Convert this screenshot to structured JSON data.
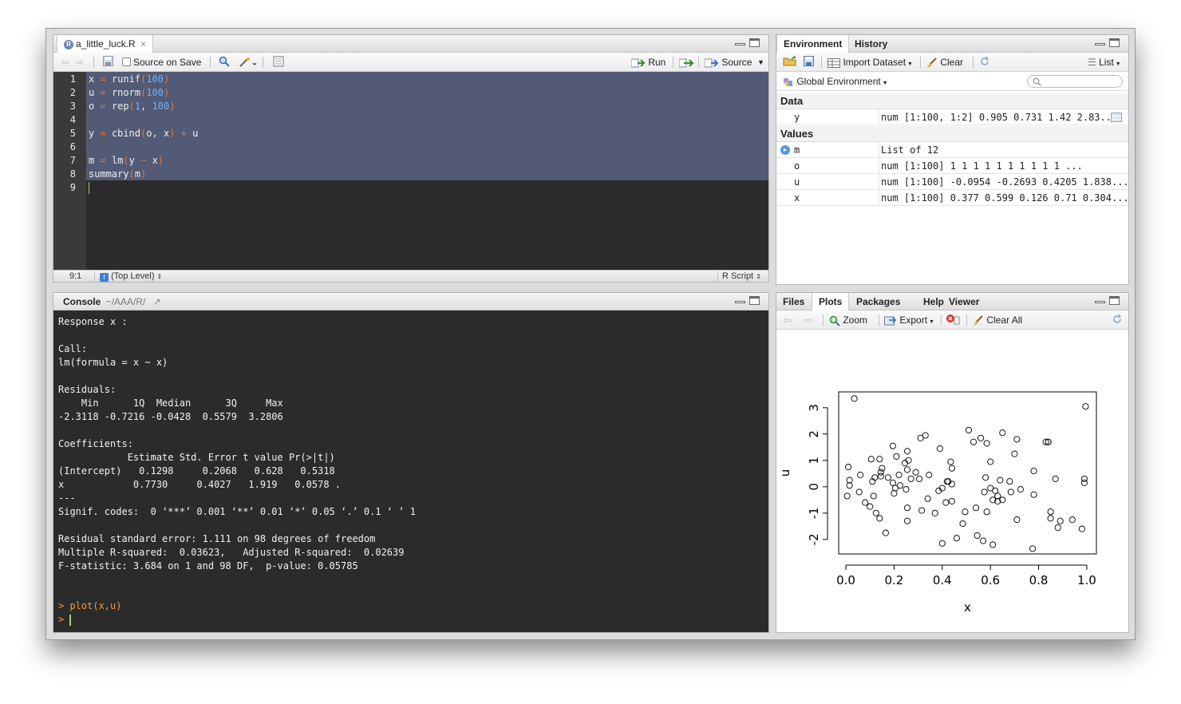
{
  "editor": {
    "tab_label": "a_little_luck.R",
    "source_on_save": "Source on Save",
    "run_label": "Run",
    "source_label": "Source",
    "lines": [
      {
        "n": "1",
        "code": "x = runif(100)"
      },
      {
        "n": "2",
        "code": "u = rnorm(100)"
      },
      {
        "n": "3",
        "code": "o = rep(1, 100)"
      },
      {
        "n": "4",
        "code": ""
      },
      {
        "n": "5",
        "code": "y = cbind(o, x) + u"
      },
      {
        "n": "6",
        "code": ""
      },
      {
        "n": "7",
        "code": "m = lm(y ~ x)"
      },
      {
        "n": "8",
        "code": "summary(m)"
      },
      {
        "n": "9",
        "code": ""
      }
    ],
    "status_position": "9:1",
    "status_scope": "(Top Level)",
    "status_filetype": "R Script"
  },
  "console": {
    "title": "Console",
    "path": "~/AAA/R/",
    "lines": [
      "Response x :",
      "",
      "Call:",
      "lm(formula = x ~ x)",
      "",
      "Residuals:",
      "    Min      1Q  Median      3Q     Max ",
      "-2.3118 -0.7216 -0.0428  0.5579  3.2806 ",
      "",
      "Coefficients:",
      "            Estimate Std. Error t value Pr(>|t|)",
      "(Intercept)   0.1298     0.2068   0.628   0.5318",
      "x            0.7730     0.4027   1.919   0.0578 .",
      "---",
      "Signif. codes:  0 ‘***’ 0.001 ‘**’ 0.01 ‘*’ 0.05 ‘.’ 0.1 ‘ ’ 1",
      "",
      "Residual standard error: 1.111 on 98 degrees of freedom",
      "Multiple R-squared:  0.03623,   Adjusted R-squared:  0.02639 ",
      "F-statistic: 3.684 on 1 and 98 DF,  p-value: 0.05785",
      "",
      ""
    ],
    "command": "> plot(x,u)",
    "prompt": ">"
  },
  "environment": {
    "tabs": [
      "Environment",
      "History"
    ],
    "import_label": "Import Dataset",
    "clear_label": "Clear",
    "list_label": "List",
    "scope_label": "Global Environment",
    "search_placeholder": "",
    "data_header": "Data",
    "values_header": "Values",
    "data_rows": [
      {
        "name": "y",
        "value": "num [1:100, 1:2] 0.905 0.731 1.42 2.83..."
      }
    ],
    "value_rows": [
      {
        "name": "m",
        "value": "List of 12"
      },
      {
        "name": "o",
        "value": "num [1:100] 1 1 1 1 1 1 1 1 1 1 ..."
      },
      {
        "name": "u",
        "value": "num [1:100] -0.0954 -0.2693 0.4205 1.838..."
      },
      {
        "name": "x",
        "value": "num [1:100] 0.377 0.599 0.126 0.71 0.304..."
      }
    ]
  },
  "plots": {
    "tabs": [
      "Files",
      "Plots",
      "Packages",
      "Help",
      "Viewer"
    ],
    "zoom_label": "Zoom",
    "export_label": "Export",
    "clear_all_label": "Clear All"
  },
  "chart_data": {
    "type": "scatter",
    "xlabel": "x",
    "ylabel": "u",
    "xlim": [
      -0.03,
      1.04
    ],
    "ylim": [
      -2.55,
      3.6
    ],
    "xticks": [
      "0.0",
      "0.2",
      "0.4",
      "0.6",
      "0.8",
      "1.0"
    ],
    "yticks": [
      "-2",
      "-1",
      "0",
      "1",
      "2",
      "3"
    ],
    "points": [
      [
        0.035,
        3.35
      ],
      [
        0.995,
        3.05
      ],
      [
        0.51,
        2.15
      ],
      [
        0.65,
        2.05
      ],
      [
        0.33,
        1.95
      ],
      [
        0.31,
        1.85
      ],
      [
        0.56,
        1.85
      ],
      [
        0.71,
        1.8
      ],
      [
        0.84,
        1.7
      ],
      [
        0.84,
        1.7
      ],
      [
        0.53,
        1.7
      ],
      [
        0.585,
        1.65
      ],
      [
        0.195,
        1.55
      ],
      [
        0.39,
        1.45
      ],
      [
        0.255,
        1.35
      ],
      [
        0.7,
        1.25
      ],
      [
        0.21,
        1.15
      ],
      [
        0.105,
        1.05
      ],
      [
        0.14,
        1.05
      ],
      [
        0.26,
        1.0
      ],
      [
        0.435,
        0.95
      ],
      [
        0.6,
        0.95
      ],
      [
        0.245,
        0.9
      ],
      [
        0.01,
        0.75
      ],
      [
        0.15,
        0.7
      ],
      [
        0.44,
        0.7
      ],
      [
        0.255,
        0.65
      ],
      [
        0.78,
        0.6
      ],
      [
        0.145,
        0.55
      ],
      [
        0.29,
        0.55
      ],
      [
        0.06,
        0.45
      ],
      [
        0.22,
        0.45
      ],
      [
        0.145,
        0.4
      ],
      [
        0.175,
        0.35
      ],
      [
        0.12,
        0.35
      ],
      [
        0.58,
        0.35
      ],
      [
        0.345,
        0.45
      ],
      [
        0.11,
        0.2
      ],
      [
        0.27,
        0.3
      ],
      [
        0.305,
        0.3
      ],
      [
        0.425,
        0.2
      ],
      [
        0.87,
        0.3
      ],
      [
        0.99,
        0.3
      ],
      [
        0.99,
        0.15
      ],
      [
        0.015,
        0.25
      ],
      [
        0.64,
        0.25
      ],
      [
        0.68,
        0.2
      ],
      [
        0.195,
        0.15
      ],
      [
        0.225,
        0.05
      ],
      [
        0.205,
        -0.05
      ],
      [
        0.44,
        0.1
      ],
      [
        0.015,
        0.05
      ],
      [
        0.25,
        -0.1
      ],
      [
        0.6,
        -0.05
      ],
      [
        0.4,
        -0.05
      ],
      [
        0.385,
        -0.15
      ],
      [
        0.62,
        -0.15
      ],
      [
        0.575,
        -0.2
      ],
      [
        0.685,
        -0.2
      ],
      [
        0.725,
        -0.1
      ],
      [
        0.78,
        -0.3
      ],
      [
        0.055,
        -0.2
      ],
      [
        0.005,
        -0.35
      ],
      [
        0.2,
        -0.25
      ],
      [
        0.115,
        -0.35
      ],
      [
        0.34,
        -0.45
      ],
      [
        0.63,
        -0.35
      ],
      [
        0.65,
        -0.5
      ],
      [
        0.61,
        -0.5
      ],
      [
        0.08,
        -0.6
      ],
      [
        0.415,
        -0.6
      ],
      [
        0.44,
        -0.55
      ],
      [
        0.255,
        -0.8
      ],
      [
        0.315,
        -0.9
      ],
      [
        0.54,
        -0.8
      ],
      [
        0.585,
        -0.95
      ],
      [
        0.1,
        -0.75
      ],
      [
        0.125,
        -1.0
      ],
      [
        0.37,
        -1.0
      ],
      [
        0.495,
        -0.95
      ],
      [
        0.85,
        -0.95
      ],
      [
        0.14,
        -1.2
      ],
      [
        0.85,
        -1.2
      ],
      [
        0.255,
        -1.3
      ],
      [
        0.71,
        -1.25
      ],
      [
        0.485,
        -1.4
      ],
      [
        0.89,
        -1.3
      ],
      [
        0.94,
        -1.25
      ],
      [
        0.88,
        -1.55
      ],
      [
        0.98,
        -1.6
      ],
      [
        0.165,
        -1.75
      ],
      [
        0.4,
        -2.15
      ],
      [
        0.57,
        -2.05
      ],
      [
        0.61,
        -2.2
      ],
      [
        0.46,
        -1.95
      ],
      [
        0.545,
        -1.85
      ],
      [
        0.775,
        -2.35
      ],
      [
        0.63,
        -0.55
      ],
      [
        0.42,
        0.2
      ],
      [
        0.83,
        1.7
      ]
    ]
  }
}
